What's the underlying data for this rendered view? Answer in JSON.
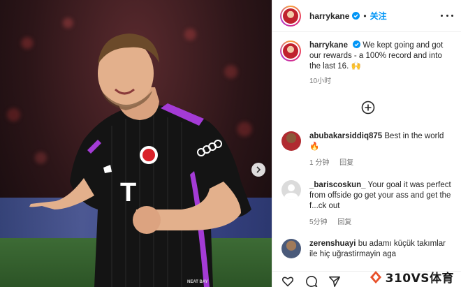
{
  "post": {
    "username": "harrykane",
    "follow_label": "关注",
    "caption_text": "We kept going and got our rewards - a 100% record and into the last 16.",
    "caption_emoji": "🙌",
    "time_ago": "10小时",
    "sponsor_text": "T",
    "shirt_brand": "adidas",
    "kit_sponsor_tag": "NEAT BAY"
  },
  "comments": [
    {
      "username": "abubakarsiddiq875",
      "text": "Best in the world",
      "emoji": "🔥",
      "time": "1 分钟",
      "reply_label": "回复"
    },
    {
      "username": "_bariscoskun_",
      "text": "Your goal it was perfect from offside go get your ass and get the f...ck out",
      "time": "5分钟",
      "reply_label": "回复"
    },
    {
      "username": "zerenshuayi",
      "text": "bu adamı küçük takımlar ile hiç uğrastirmayin aga"
    }
  ],
  "watermark": {
    "text": "310VS体育"
  },
  "colors": {
    "accent": "#0095f6",
    "kit_purple": "#a43bd6",
    "kit_black": "#141414"
  },
  "icons": [
    "verified-badge-icon",
    "more-options-icon",
    "plus-circle-icon",
    "carousel-next-icon",
    "heart-icon",
    "comment-icon",
    "share-icon",
    "watermark-logo-icon"
  ]
}
